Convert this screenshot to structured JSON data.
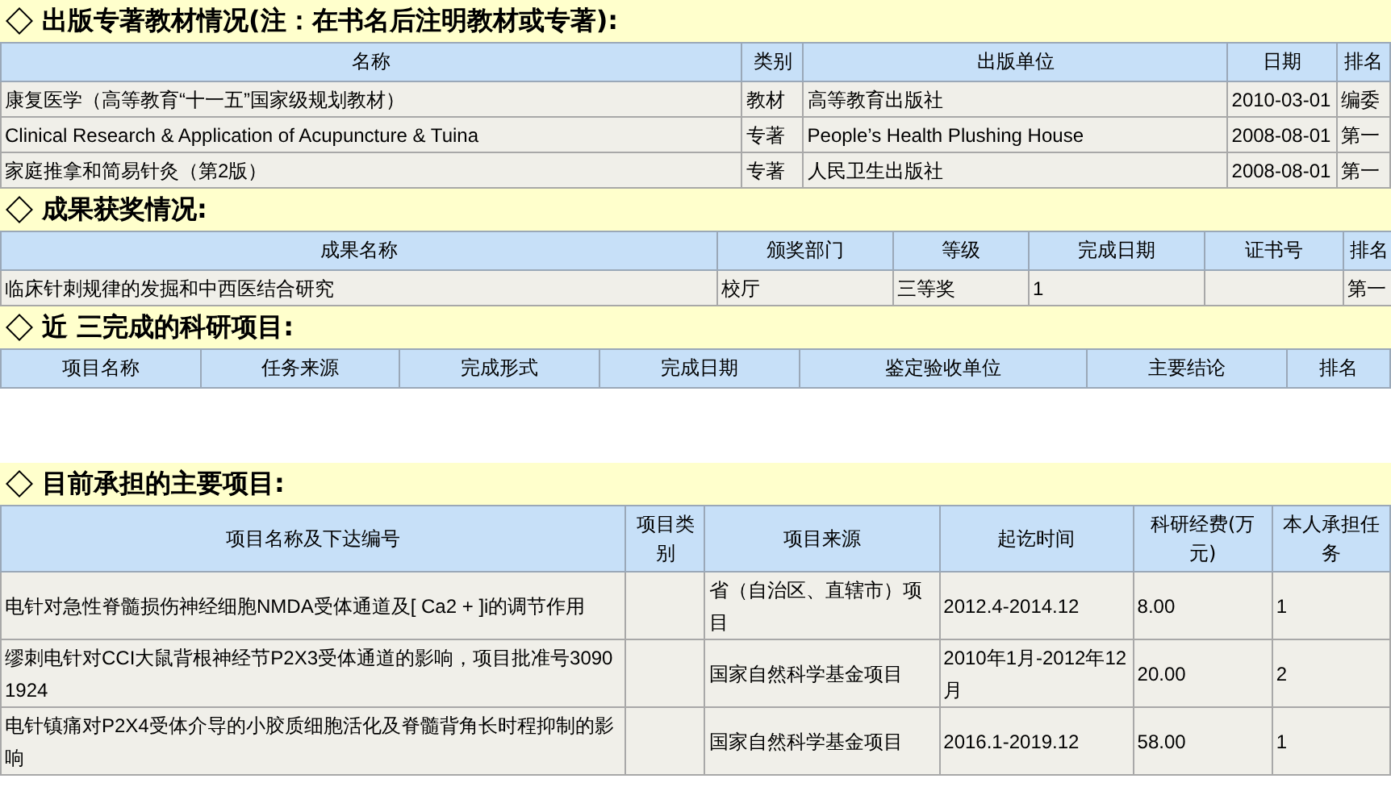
{
  "sections": [
    {
      "title": "出版专著教材情况(注：在书名后注明教材或专著):",
      "columns": [
        "名称",
        "类别",
        "出版单位",
        "日期",
        "排名"
      ],
      "rows": [
        [
          "康复医学（高等教育“十一五”国家级规划教材）",
          "教材",
          "高等教育出版社",
          "2010-03-01",
          "编委"
        ],
        [
          "Clinical Research & Application of Acupuncture & Tuina",
          "专著",
          "People’s Health Plushing House",
          "2008-08-01",
          "第一"
        ],
        [
          "家庭推拿和简易针灸（第2版）",
          "专著",
          "人民卫生出版社",
          "2008-08-01",
          "第一"
        ]
      ]
    },
    {
      "title": "成果获奖情况:",
      "columns": [
        "成果名称",
        "颁奖部门",
        "等级",
        "完成日期",
        "证书号",
        "排名"
      ],
      "rows": [
        [
          "临床针刺规律的发掘和中西医结合研究",
          "校厅",
          "三等奖",
          "1",
          "",
          "第一"
        ]
      ]
    },
    {
      "title": "近  三完成的科研项目:",
      "columns": [
        "项目名称",
        "任务来源",
        "完成形式",
        "完成日期",
        "鉴定验收单位",
        "主要结论",
        "排名"
      ]
    },
    {
      "title": "目前承担的主要项目:",
      "columns": [
        "项目名称及下达编号",
        "项目类别",
        "项目来源",
        "起讫时间",
        "科研经费(万元)",
        "本人承担任务"
      ],
      "rows": [
        [
          "电针对急性脊髓损伤神经细胞NMDA受体通道及[ Ca2 + ]i的调节作用",
          "",
          "省（自治区、直辖市）项目",
          "2012.4-2014.12",
          "8.00",
          "1"
        ],
        [
          "缪刺电针对CCI大鼠背根神经节P2X3受体通道的影响，项目批准号30901924",
          "",
          "国家自然科学基金项目",
          "2010年1月-2012年12月",
          "20.00",
          "2"
        ],
        [
          "电针镇痛对P2X4受体介导的小胶质细胞活化及脊髓背角长时程抑制的影响",
          "",
          "国家自然科学基金项目",
          "2016.1-2019.12",
          "58.00",
          "1"
        ]
      ]
    }
  ]
}
